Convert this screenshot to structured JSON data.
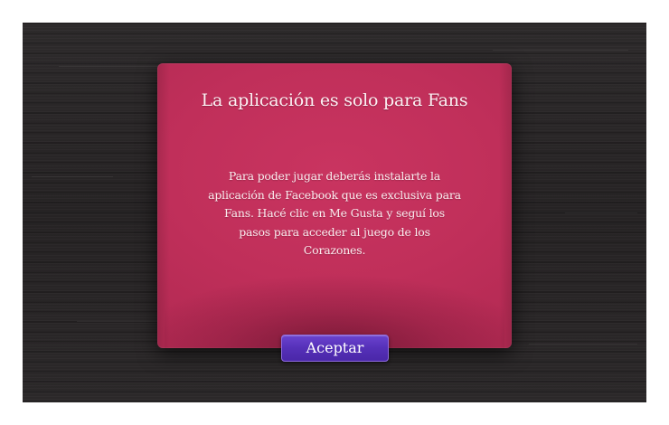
{
  "dialog": {
    "title": "La aplicación es solo para Fans",
    "message": "Para poder jugar deberás instalarte la aplicación de Facebook que es exclusiva para Fans. Hacé clic en Me Gusta y seguí los pasos para acceder al juego de los Corazones.",
    "accept_label": "Aceptar"
  },
  "colors": {
    "background": "#272425",
    "dialog": "#c02f5a",
    "button": "#5530b8"
  }
}
